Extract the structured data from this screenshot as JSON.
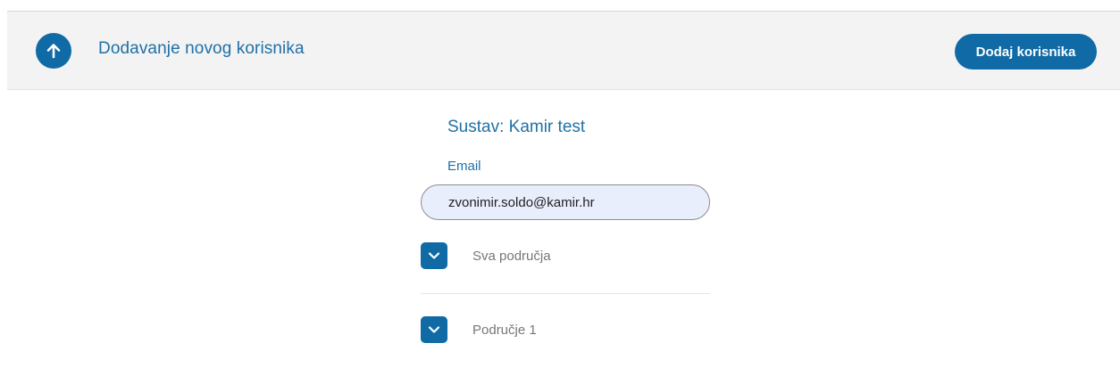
{
  "header": {
    "title": "Dodavanje novog korisnika",
    "add_user_label": "Dodaj korisnika",
    "back_icon": "arrow-up-icon"
  },
  "form": {
    "system_title": "Sustav: Kamir test",
    "email_label": "Email",
    "email_value": "zvonimir.soldo@kamir.hr",
    "areas": [
      {
        "label": "Sva područja",
        "icon": "chevron-down-icon"
      },
      {
        "label": "Područje 1",
        "icon": "chevron-down-icon"
      }
    ]
  },
  "colors": {
    "accent": "#0f6aa5",
    "title_text": "#1f70a6",
    "header_bg": "#f3f3f3",
    "input_bg": "#e9eefc",
    "muted_text": "#777777"
  }
}
